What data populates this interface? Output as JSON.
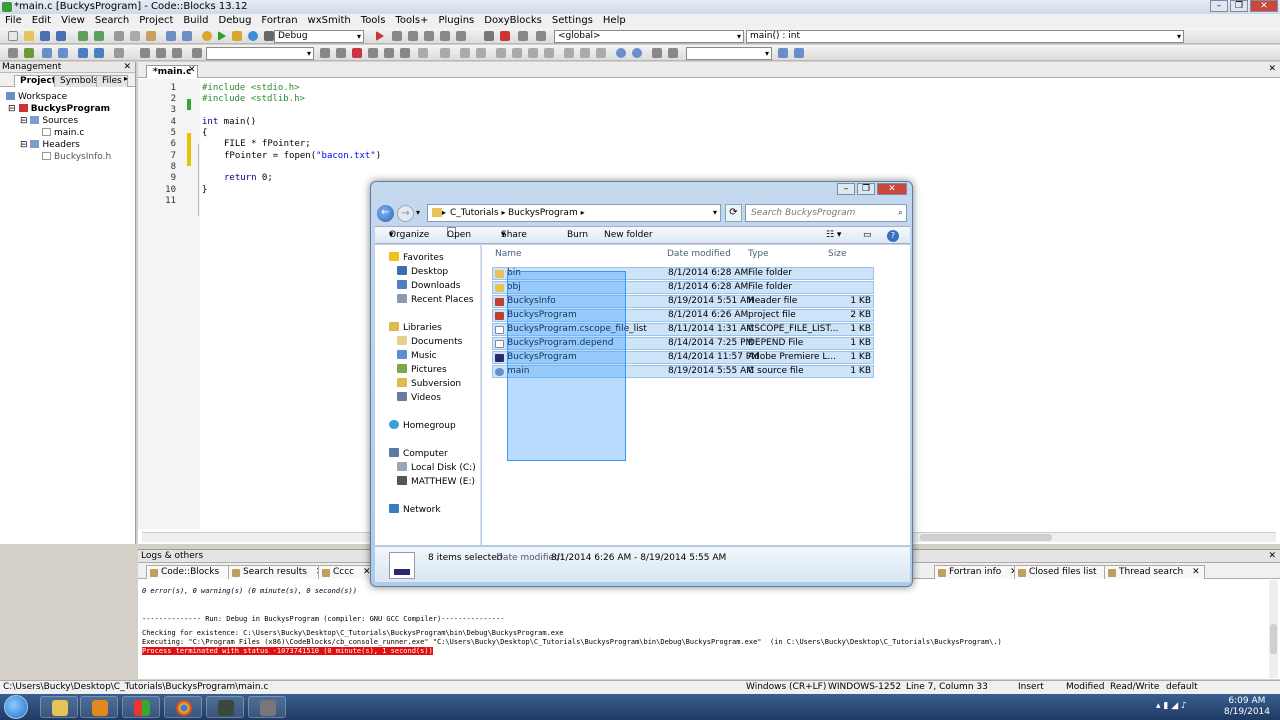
{
  "window": {
    "title": "*main.c [BuckysProgram] - Code::Blocks 13.12"
  },
  "menu": [
    "File",
    "Edit",
    "View",
    "Search",
    "Project",
    "Build",
    "Debug",
    "Fortran",
    "wxSmith",
    "Tools",
    "Tools+",
    "Plugins",
    "DoxyBlocks",
    "Settings",
    "Help"
  ],
  "toolbar": {
    "build_target": "Debug",
    "scope": "<global>",
    "function": "main() : int"
  },
  "management": {
    "title": "Management",
    "tabs": [
      "Projects",
      "Symbols",
      "Files"
    ],
    "tree": {
      "workspace": "Workspace",
      "project": "BuckysProgram",
      "sources": "Sources",
      "main_c": "main.c",
      "headers": "Headers",
      "header_file": "BuckysInfo.h"
    }
  },
  "editor": {
    "tab": "*main.c",
    "lines": [
      "1",
      "2",
      "3",
      "4",
      "5",
      "6",
      "7",
      "8",
      "9",
      "10",
      "11"
    ],
    "code": {
      "l1": "#include <stdio.h>",
      "l2": "#include <stdlib.h>",
      "l4a": "int",
      "l4b": " main()",
      "l5": "{",
      "l6": "FILE * fPointer;",
      "l7a": "fPointer = fopen(",
      "l7b": "\"bacon.txt\"",
      "l7c": ")",
      "l9a": "return",
      "l9b": " 0;",
      "l10": "}"
    }
  },
  "logs": {
    "title": "Logs & others",
    "tabs": [
      "Code::Blocks",
      "Search results",
      "Cccc",
      "Fortran info",
      "Closed files list",
      "Thread search"
    ],
    "lines": {
      "l0": "0 error(s), 0 warning(s) (0 minute(s), 0 second(s))",
      "l1": "-------------- Run: Debug in BuckysProgram (compiler: GNU GCC Compiler)---------------",
      "l2": "Checking for existence: C:\\Users\\Bucky\\Desktop\\C_Tutorials\\BuckysProgram\\bin\\Debug\\BuckysProgram.exe",
      "l3": "Executing: \"C:\\Program Files (x86)\\CodeBlocks/cb_console_runner.exe\" \"C:\\Users\\Bucky\\Desktop\\C_Tutorials\\BuckysProgram\\bin\\Debug\\BuckysProgram.exe\"  (in C:\\Users\\Bucky\\Desktop\\C_Tutorials\\BuckysProgram\\.)",
      "l4": "Process terminated with status -1073741510 (0 minute(s), 1 second(s))"
    }
  },
  "statusbar": {
    "path": "C:\\Users\\Bucky\\Desktop\\C_Tutorials\\BuckysProgram\\main.c",
    "eol": "Windows (CR+LF)",
    "encoding": "WINDOWS-1252",
    "position": "Line 7, Column 33",
    "mode": "Insert",
    "modified": "Modified",
    "access": "Read/Write",
    "profile": "default"
  },
  "explorer": {
    "breadcrumb": [
      "C_Tutorials",
      "BuckysProgram"
    ],
    "search_placeholder": "Search BuckysProgram",
    "commands": [
      "Organize",
      "Open",
      "Share with",
      "Burn",
      "New folder"
    ],
    "nav": {
      "favorites": "Favorites",
      "desktop": "Desktop",
      "downloads": "Downloads",
      "recent": "Recent Places",
      "libraries": "Libraries",
      "documents": "Documents",
      "music": "Music",
      "pictures": "Pictures",
      "subversion": "Subversion",
      "videos": "Videos",
      "homegroup": "Homegroup",
      "computer": "Computer",
      "local_disk": "Local Disk (C:)",
      "matthew": "MATTHEW (E:)",
      "network": "Network"
    },
    "columns": {
      "name": "Name",
      "date": "Date modified",
      "type": "Type",
      "size": "Size"
    },
    "files": [
      {
        "name": "bin",
        "date": "8/1/2014 6:28 AM",
        "type": "File folder",
        "size": ""
      },
      {
        "name": "obj",
        "date": "8/1/2014 6:28 AM",
        "type": "File folder",
        "size": ""
      },
      {
        "name": "BuckysInfo",
        "date": "8/19/2014 5:51 AM",
        "type": "Header file",
        "size": "1 KB"
      },
      {
        "name": "BuckysProgram",
        "date": "8/1/2014 6:26 AM",
        "type": "project file",
        "size": "2 KB"
      },
      {
        "name": "BuckysProgram.cscope_file_list",
        "date": "8/11/2014 1:31 AM",
        "type": "CSCOPE_FILE_LIST...",
        "size": "1 KB"
      },
      {
        "name": "BuckysProgram.depend",
        "date": "8/14/2014 7:25 PM",
        "type": "DEPEND File",
        "size": "1 KB"
      },
      {
        "name": "BuckysProgram",
        "date": "8/14/2014 11:57 PM",
        "type": "Adobe Premiere L...",
        "size": "1 KB"
      },
      {
        "name": "main",
        "date": "8/19/2014 5:55 AM",
        "type": "C source file",
        "size": "1 KB"
      }
    ],
    "details": {
      "count": "8 items selected",
      "date_label": "Date modified:",
      "date_range": "8/1/2014 6:26 AM - 8/19/2014 5:55 AM"
    }
  },
  "taskbar": {
    "time": "6:09 AM",
    "date": "8/19/2014"
  }
}
